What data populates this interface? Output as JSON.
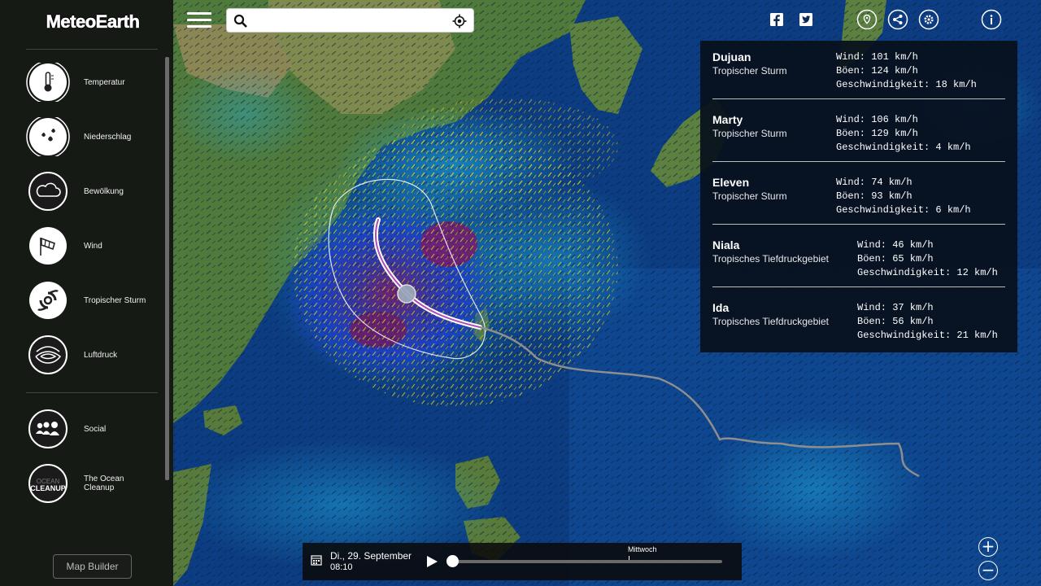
{
  "app": {
    "title": "MeteoEarth"
  },
  "sidebar": {
    "items": [
      {
        "label": "Temperatur",
        "icon": "thermometer-icon"
      },
      {
        "label": "Niederschlag",
        "icon": "rain-drops-icon"
      },
      {
        "label": "Bewölkung",
        "icon": "cloud-icon"
      },
      {
        "label": "Wind",
        "icon": "windsock-icon"
      },
      {
        "label": "Tropischer Sturm",
        "icon": "hurricane-icon"
      },
      {
        "label": "Luftdruck",
        "icon": "pressure-icon"
      }
    ],
    "extras": [
      {
        "label": "Social",
        "icon": "people-icon"
      },
      {
        "label": "The Ocean\nCleanup",
        "icon": "ocean-cleanup-icon",
        "icon_text_1": "OCEAN",
        "icon_text_2": "CLEANUP"
      }
    ],
    "map_builder_label": "Map Builder"
  },
  "search": {
    "placeholder": "",
    "value": ""
  },
  "top_icons": [
    "facebook-icon",
    "twitter-icon",
    "location-pin-icon",
    "share-icon",
    "settings-icon",
    "info-icon"
  ],
  "storms": [
    {
      "name": "Dujuan",
      "type": "Tropischer Sturm",
      "wind": "Wind: 101 km/h",
      "gusts": "Böen: 124 km/h",
      "speed": "Geschwindigkeit: 18 km/h"
    },
    {
      "name": "Marty",
      "type": "Tropischer Sturm",
      "wind": "Wind: 106 km/h",
      "gusts": "Böen: 129 km/h",
      "speed": "Geschwindigkeit: 4 km/h"
    },
    {
      "name": "Eleven",
      "type": "Tropischer Sturm",
      "wind": "Wind: 74 km/h",
      "gusts": "Böen: 93 km/h",
      "speed": "Geschwindigkeit: 6 km/h"
    },
    {
      "name": "Niala",
      "type": "Tropisches Tiefdruckgebiet",
      "wind": "Wind: 46 km/h",
      "gusts": "Böen: 65 km/h",
      "speed": "Geschwindigkeit: 12 km/h"
    },
    {
      "name": "Ida",
      "type": "Tropisches Tiefdruckgebiet",
      "wind": "Wind: 37 km/h",
      "gusts": "Böen: 56 km/h",
      "speed": "Geschwindigkeit: 21 km/h"
    }
  ],
  "timeline": {
    "date": "Di., 29. September",
    "time": "08:10",
    "day_marker": "Mittwoch",
    "progress": 0
  },
  "zoom": {
    "in": "+",
    "out": "−"
  },
  "colors": {
    "ocean_deep": "#0a3b7c",
    "ocean_light": "#1e8fd8",
    "land": "#4d7a3a",
    "panel_bg": "#070f1c",
    "storm_track": "#8f8f8f"
  }
}
